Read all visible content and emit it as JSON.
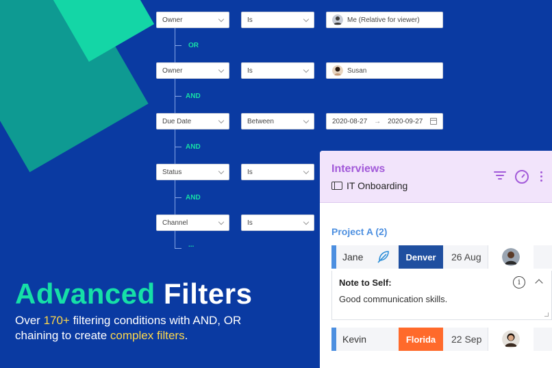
{
  "filters": [
    {
      "field": "Owner",
      "operator": "Is",
      "value": "Me (Relative for viewer)"
    },
    {
      "field": "Owner",
      "operator": "Is",
      "value": "Susan"
    },
    {
      "field": "Due Date",
      "operator": "Between",
      "date_from": "2020-08-27",
      "date_to": "2020-09-27"
    },
    {
      "field": "Status",
      "operator": "Is",
      "value": ""
    },
    {
      "field": "Channel",
      "operator": "Is",
      "value": ""
    }
  ],
  "connectors": [
    "OR",
    "AND",
    "AND",
    "AND",
    "..."
  ],
  "headline": {
    "part1": "Advanced",
    "part2": "Filters"
  },
  "subtitle": {
    "line1_pre": "Over ",
    "line1_hl": "170+",
    "line1_post": " filtering conditions with AND, OR",
    "line2_pre": "chaining to create ",
    "line2_hl": "complex filters",
    "line2_post": "."
  },
  "panel": {
    "title": "Interviews",
    "board": "IT Onboarding",
    "group": "Project A (2)",
    "rows": [
      {
        "name": "Jane",
        "location": "Denver",
        "location_color": "#1f4fa0",
        "date": "26 Aug"
      },
      {
        "name": "Kevin",
        "location": "Florida",
        "location_color": "#ff6a2b",
        "date": "22 Sep"
      }
    ],
    "note": {
      "title": "Note to Self:",
      "body": "Good communication skills."
    }
  },
  "colors": {
    "background": "#0a3aa2",
    "accent_green": "#16dfa7",
    "accent_yellow": "#ffd84a",
    "panel_purple": "#a259d9",
    "group_blue": "#4c8fe0"
  },
  "icons": [
    "chevron-down-icon",
    "calendar-icon",
    "board-icon",
    "filter-icon",
    "timer-icon",
    "kebab-menu-icon",
    "feather-icon",
    "info-icon",
    "chevron-up-icon"
  ]
}
